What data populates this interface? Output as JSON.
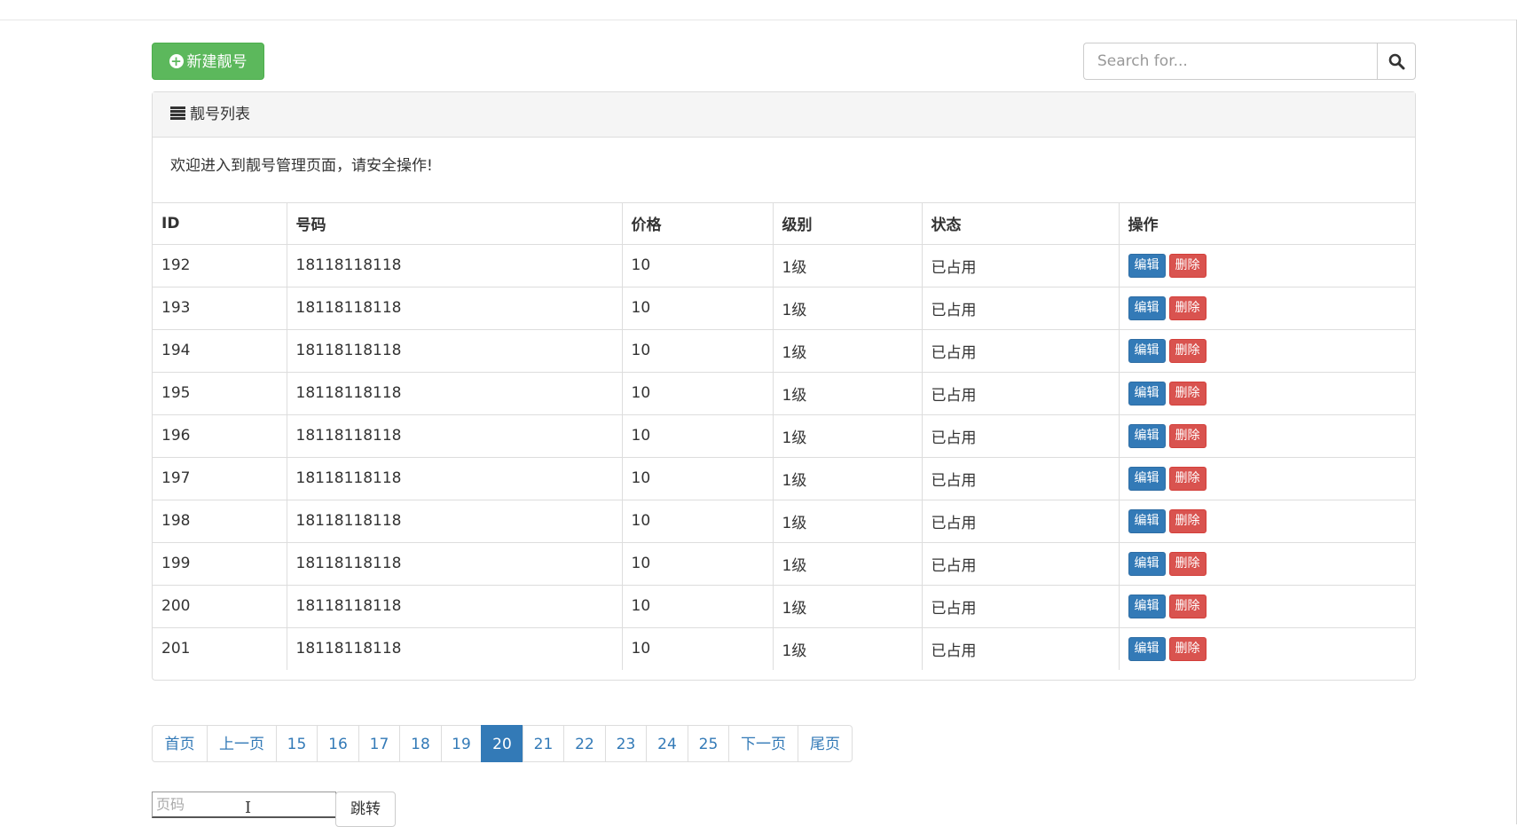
{
  "toolbar": {
    "new_button_label": "新建靓号",
    "search_placeholder": "Search for..."
  },
  "panel": {
    "title": "靓号列表",
    "welcome": "欢迎进入到靓号管理页面，请安全操作!"
  },
  "table": {
    "headers": [
      "ID",
      "号码",
      "价格",
      "级别",
      "状态",
      "操作"
    ],
    "rows": [
      {
        "id": "192",
        "mobile": "18118118118",
        "price": "10",
        "level": "1级",
        "status": "已占用"
      },
      {
        "id": "193",
        "mobile": "18118118118",
        "price": "10",
        "level": "1级",
        "status": "已占用"
      },
      {
        "id": "194",
        "mobile": "18118118118",
        "price": "10",
        "level": "1级",
        "status": "已占用"
      },
      {
        "id": "195",
        "mobile": "18118118118",
        "price": "10",
        "level": "1级",
        "status": "已占用"
      },
      {
        "id": "196",
        "mobile": "18118118118",
        "price": "10",
        "level": "1级",
        "status": "已占用"
      },
      {
        "id": "197",
        "mobile": "18118118118",
        "price": "10",
        "level": "1级",
        "status": "已占用"
      },
      {
        "id": "198",
        "mobile": "18118118118",
        "price": "10",
        "level": "1级",
        "status": "已占用"
      },
      {
        "id": "199",
        "mobile": "18118118118",
        "price": "10",
        "level": "1级",
        "status": "已占用"
      },
      {
        "id": "200",
        "mobile": "18118118118",
        "price": "10",
        "level": "1级",
        "status": "已占用"
      },
      {
        "id": "201",
        "mobile": "18118118118",
        "price": "10",
        "level": "1级",
        "status": "已占用"
      }
    ],
    "edit_label": "编辑",
    "delete_label": "删除"
  },
  "pagination": {
    "items": [
      "首页",
      "上一页",
      "15",
      "16",
      "17",
      "18",
      "19",
      "20",
      "21",
      "22",
      "23",
      "24",
      "25",
      "下一页",
      "尾页"
    ],
    "active": "20"
  },
  "jump": {
    "placeholder": "页码",
    "button_label": "跳转"
  },
  "colors": {
    "success": "#5cb85c",
    "primary": "#337ab7",
    "danger": "#d9534f"
  },
  "icons": {
    "new_button": "plus-circle-icon",
    "search": "search-icon",
    "panel": "list-icon"
  }
}
